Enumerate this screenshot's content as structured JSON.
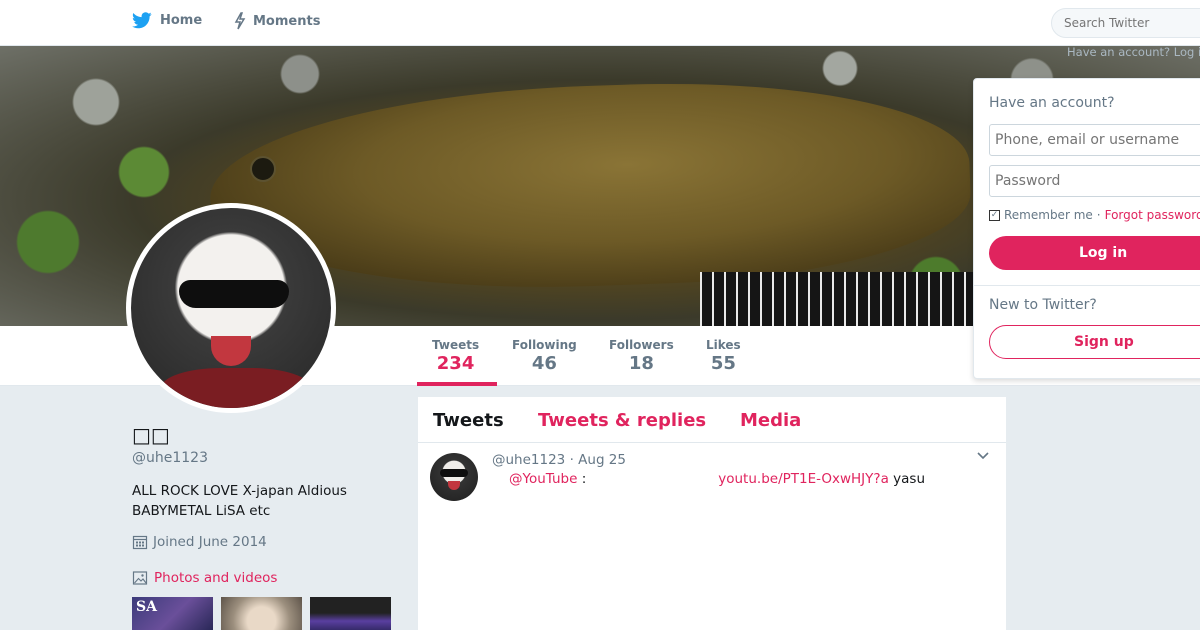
{
  "nav": {
    "home_label": "Home",
    "moments_label": "Moments",
    "search_placeholder": "Search Twitter"
  },
  "login_dropdown": {
    "ghost_text": "Have an account? Log in",
    "title": "Have an account?",
    "username_placeholder": "Phone, email or username",
    "password_placeholder": "Password",
    "remember_label": "Remember me",
    "separator": "·",
    "forgot_label": "Forgot password?",
    "login_label": "Log in",
    "new_to": "New to Twitter?",
    "signup_label": "Sign up"
  },
  "profile": {
    "display_name": "□□",
    "screen_name": "@uhe1123",
    "bio": "ALL ROCK LOVE X-japan Aldious BABYMETAL LiSA etc",
    "joined": "Joined June 2014",
    "photos_label": "Photos and videos",
    "thumb1_text": "SA"
  },
  "stats": [
    {
      "label": "Tweets",
      "value": "234"
    },
    {
      "label": "Following",
      "value": "46"
    },
    {
      "label": "Followers",
      "value": "18"
    },
    {
      "label": "Likes",
      "value": "55"
    }
  ],
  "timeline": {
    "tabs": [
      "Tweets",
      "Tweets & replies",
      "Media"
    ],
    "tweet": {
      "meta": "@uhe1123 · Aug 25",
      "mention": "@YouTube",
      "colon": " :",
      "link": "youtu.be/PT1E-OxwHJY?a",
      "after": " yasu"
    }
  },
  "colors": {
    "accent": "#e0245e",
    "twitter_blue": "#1da1f2",
    "text_secondary": "#657786",
    "background": "#e6ecf0"
  }
}
